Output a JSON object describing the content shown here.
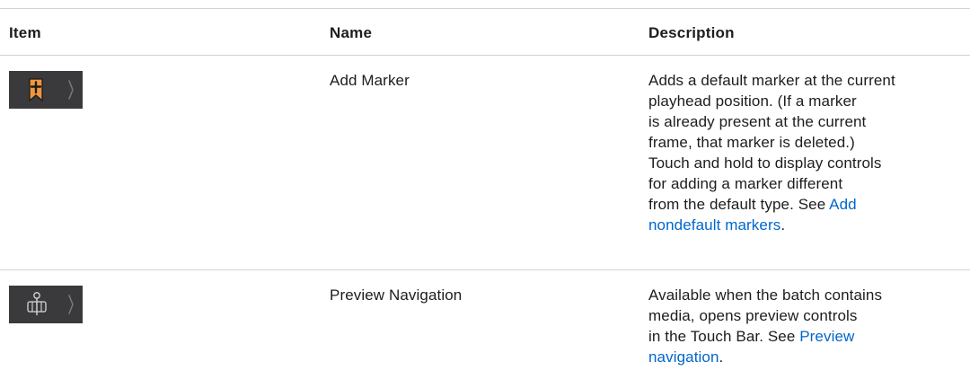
{
  "table": {
    "headers": {
      "item": "Item",
      "name": "Name",
      "description": "Description"
    },
    "rows": [
      {
        "icon": "add-marker-icon",
        "name": "Add Marker",
        "description_lines": [
          "Adds a default marker at the current",
          "playhead position. (If a marker",
          "is already present at the current",
          "frame, that marker is deleted.)",
          "Touch and hold to display controls",
          "for adding a marker different",
          "from the default type. See "
        ],
        "link_line1": "Add",
        "link_line2": "nondefault markers",
        "trailing": "."
      },
      {
        "icon": "preview-navigation-icon",
        "name": "Preview Navigation",
        "description_lines": [
          "Available when the batch contains",
          "media, opens preview controls",
          "in the Touch Bar. See "
        ],
        "link_line1": "Preview",
        "link_line2": "navigation",
        "trailing": "."
      }
    ]
  },
  "colors": {
    "accent_orange": "#f0963c",
    "touchbar_bg": "#3a3a3c",
    "link": "#0066cc",
    "rule": "#d2d2d7"
  }
}
